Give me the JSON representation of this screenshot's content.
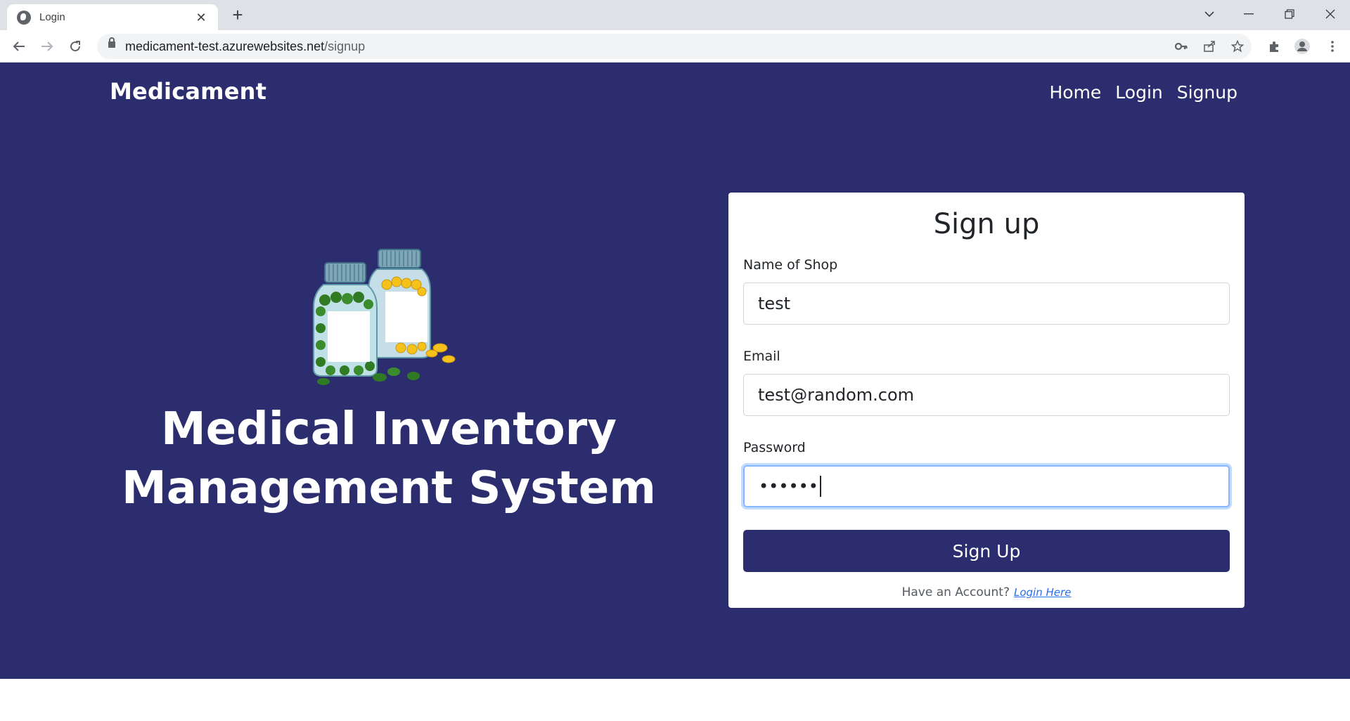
{
  "browser": {
    "tab_title": "Login",
    "new_tab_label": "+",
    "url_host": "medicament-test.azurewebsites.net",
    "url_path": "/signup"
  },
  "nav": {
    "brand": "Medicament",
    "links": [
      "Home",
      "Login",
      "Signup"
    ]
  },
  "hero": {
    "title": "Medical Inventory Management System"
  },
  "form": {
    "heading": "Sign up",
    "shop_label": "Name of Shop",
    "shop_value": "test",
    "email_label": "Email",
    "email_value": "test@random.com",
    "password_label": "Password",
    "password_value": "••••••",
    "submit_label": "Sign Up",
    "account_prompt": "Have an Account?",
    "login_link": "Login Here"
  },
  "colors": {
    "page_bg": "#2b2d6e",
    "button_bg": "#2b2d6e",
    "focus_ring": "#86b7fe",
    "link": "#2a6ee8"
  }
}
